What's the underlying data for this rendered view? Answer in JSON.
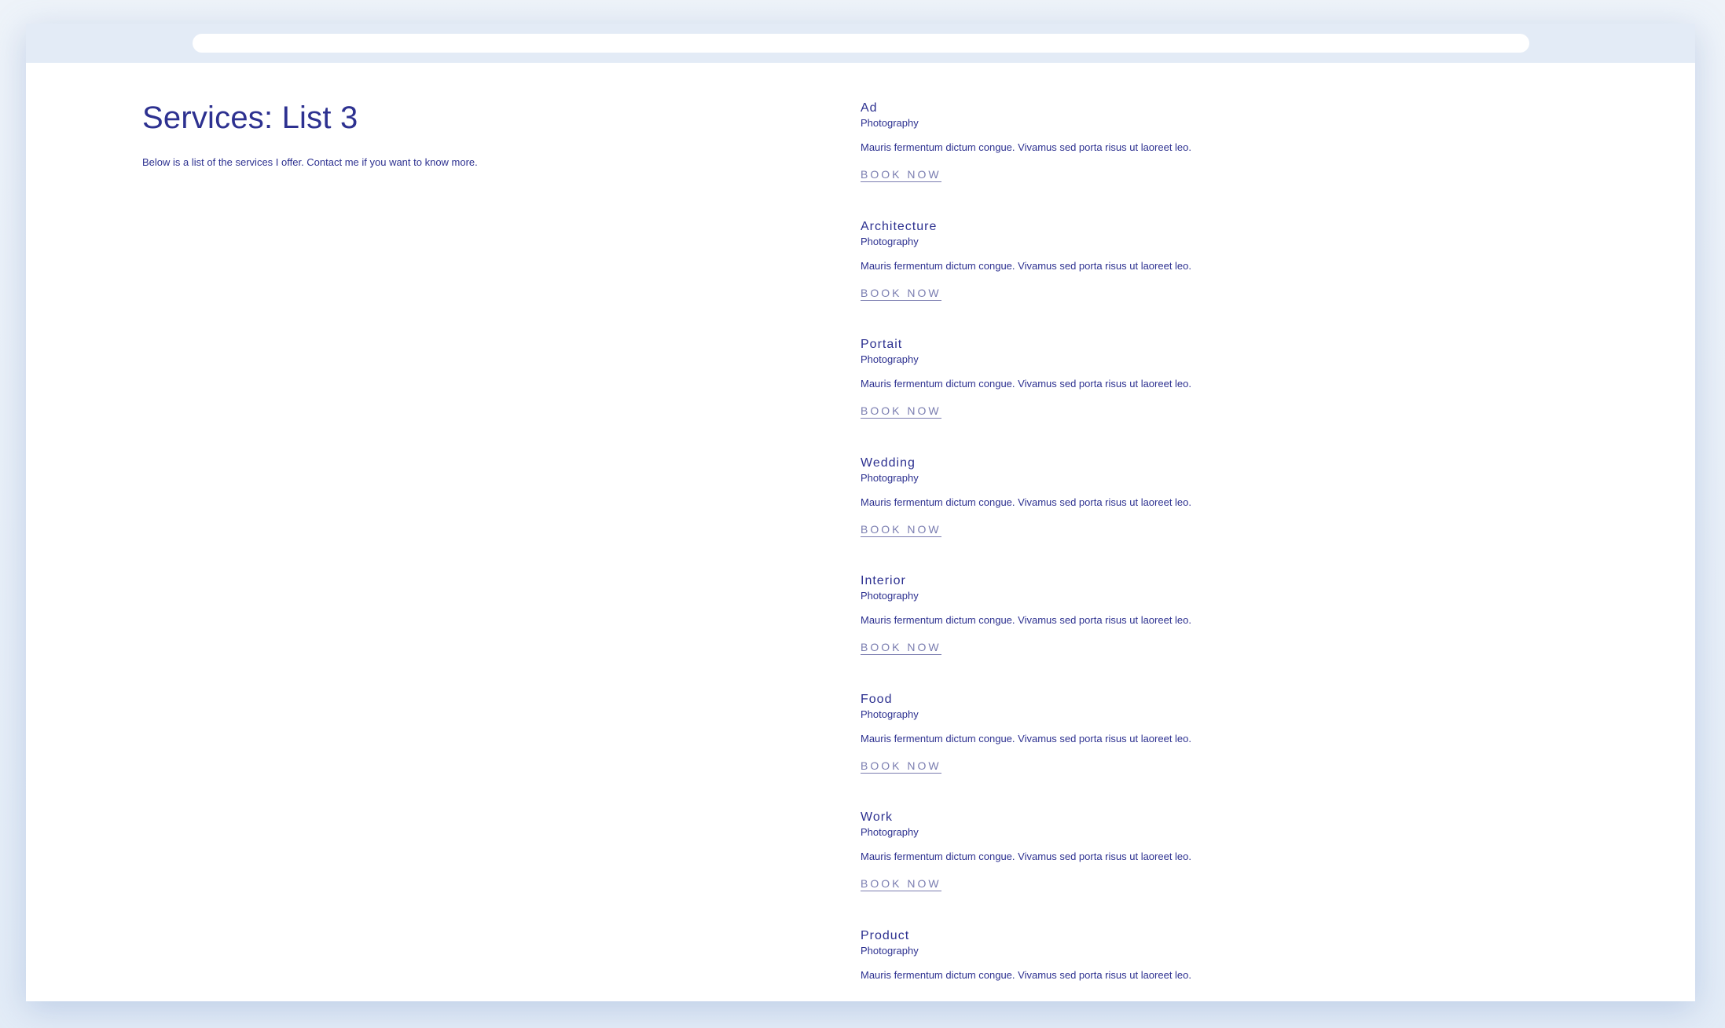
{
  "page": {
    "title": "Services: List 3",
    "intro": "Below is a list of the services I offer. Contact me if you want to know more."
  },
  "services": [
    {
      "name": "Ad",
      "category": "Photography",
      "description": "Mauris fermentum dictum congue. Vivamus sed porta risus ut laoreet leo.",
      "cta": "BOOK NOW"
    },
    {
      "name": "Architecture",
      "category": "Photography",
      "description": "Mauris fermentum dictum congue. Vivamus sed porta risus ut laoreet leo.",
      "cta": "BOOK NOW"
    },
    {
      "name": "Portait",
      "category": "Photography",
      "description": "Mauris fermentum dictum congue. Vivamus sed porta risus ut laoreet leo.",
      "cta": "BOOK NOW"
    },
    {
      "name": "Wedding",
      "category": "Photography",
      "description": "Mauris fermentum dictum congue. Vivamus sed porta risus ut laoreet leo.",
      "cta": "BOOK NOW"
    },
    {
      "name": "Interior",
      "category": "Photography",
      "description": "Mauris fermentum dictum congue. Vivamus sed porta risus ut laoreet leo.",
      "cta": "BOOK NOW"
    },
    {
      "name": "Food",
      "category": "Photography",
      "description": "Mauris fermentum dictum congue. Vivamus sed porta risus ut laoreet leo.",
      "cta": "BOOK NOW"
    },
    {
      "name": "Work",
      "category": "Photography",
      "description": "Mauris fermentum dictum congue. Vivamus sed porta risus ut laoreet leo.",
      "cta": "BOOK NOW"
    },
    {
      "name": "Product",
      "category": "Photography",
      "description": "Mauris fermentum dictum congue. Vivamus sed porta risus ut laoreet leo."
    }
  ],
  "colors": {
    "text": "#2d3190",
    "link": "#7a7db0",
    "background": "#ffffff",
    "topbar": "#e3ebf6"
  }
}
